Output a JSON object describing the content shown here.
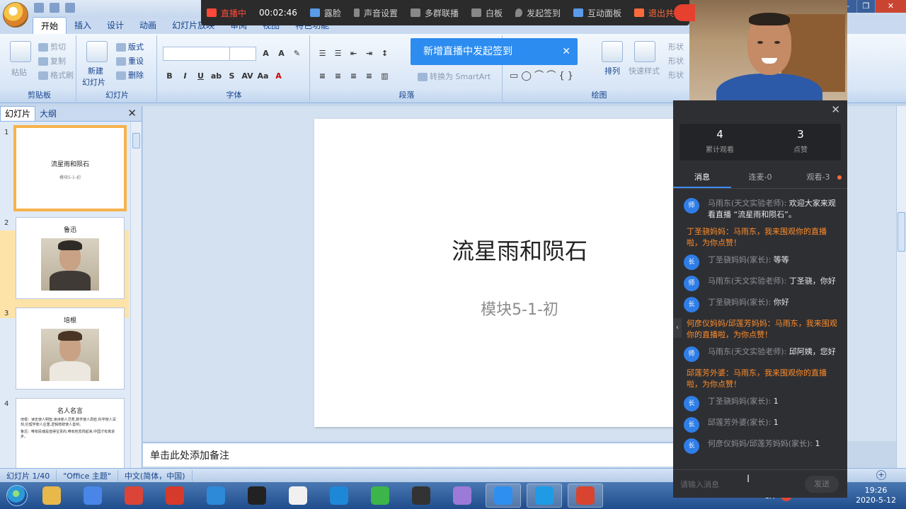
{
  "ppt": {
    "tabs": [
      "开始",
      "插入",
      "设计",
      "动画",
      "幻灯片放映",
      "审阅",
      "视图",
      "特色功能"
    ],
    "ribbon": {
      "clipboard": {
        "paste": "粘贴",
        "cut": "剪切",
        "copy": "复制",
        "format_painter": "格式刷",
        "label": "剪贴板"
      },
      "slides": {
        "new_slide": "新建",
        "new_slide2": "幻灯片",
        "layout": "版式",
        "reset": "重设",
        "delete": "删除",
        "label": "幻灯片"
      },
      "font": {
        "label": "字体"
      },
      "paragraph": {
        "convert_smartart": "转换为 SmartArt",
        "label": "段落"
      },
      "drawing": {
        "arrange": "排列",
        "quick_styles": "快速样式",
        "shape_fill": "形状",
        "shape_outline": "形状",
        "shape_effect": "形状",
        "label": "绘图"
      }
    },
    "panel_tabs": [
      "幻灯片",
      "大纲"
    ],
    "thumbs": [
      {
        "num": "1",
        "title": "流星雨和陨石",
        "sub": "模块5-1-初"
      },
      {
        "num": "2",
        "title": "鲁迅"
      },
      {
        "num": "3",
        "title": "培根"
      },
      {
        "num": "4",
        "title": "名人名言",
        "bullets": [
          "培根：读史使人明智,读诗使人灵秀,数学使人周密,科学使人深刻,伦理学使人庄重,逻辑修辞使人善辩。",
          "鲁迅：唯有民魂是值得宝贵的,唯有他发扬起来,中国才有真进步。"
        ]
      }
    ],
    "slide": {
      "title": "流星雨和陨石",
      "subtitle": "模块5-1-初"
    },
    "notes_placeholder": "单击此处添加备注",
    "status": {
      "slide_num": "幻灯片 1/40",
      "theme": "\"Office 主题\"",
      "lang": "中文(简体，中国)"
    }
  },
  "live": {
    "status": "直播中",
    "timer": "00:02:46",
    "camera": "露脸",
    "audio": "声音设置",
    "multi": "多群联播",
    "whiteboard": "白板",
    "signin": "发起签到",
    "interact": "互动面板",
    "exit": "退出共享",
    "toast": "新增直播中发起签到"
  },
  "chat": {
    "stats": {
      "views": "4",
      "views_label": "累计观看",
      "likes": "3",
      "likes_label": "点赞"
    },
    "tabs": [
      "消息",
      "连麦-0",
      "观看-3"
    ],
    "messages": [
      {
        "type": "user",
        "avatar": "师",
        "name": "马雨东(天文实验老师):",
        "text": "欢迎大家来观看直播 “流星雨和陨石”。"
      },
      {
        "type": "sys",
        "text": "丁圣骁妈妈：马雨东，我来围观你的直播啦，为你点赞！"
      },
      {
        "type": "user",
        "avatar": "长",
        "name": "丁圣骁妈妈(家长):",
        "text": "等等"
      },
      {
        "type": "user",
        "avatar": "师",
        "name": "马雨东(天文实验老师):",
        "text": "丁圣骁，你好"
      },
      {
        "type": "user",
        "avatar": "长",
        "name": "丁圣骁妈妈(家长):",
        "text": "你好"
      },
      {
        "type": "sys",
        "text": "何彦仪妈妈/邱莲芳妈妈：马雨东，我来围观你的直播啦，为你点赞！"
      },
      {
        "type": "user",
        "avatar": "师",
        "name": "马雨东(天文实验老师):",
        "text": "邱阿姨，您好"
      },
      {
        "type": "sys",
        "text": "邱莲芳外婆：马雨东，我来围观你的直播啦，为你点赞！"
      },
      {
        "type": "user",
        "avatar": "长",
        "name": "丁圣骁妈妈(家长):",
        "text": "1"
      },
      {
        "type": "user",
        "avatar": "长",
        "name": "邱莲芳外婆(家长):",
        "text": "1"
      },
      {
        "type": "user",
        "avatar": "长",
        "name": "何彦仪妈妈/邱莲芳妈妈(家长):",
        "text": "1"
      }
    ],
    "input_placeholder": "请输入消息",
    "send": "发送"
  },
  "taskbar": {
    "ime": "CH",
    "time": "19:26",
    "date": "2020-5-12",
    "apps": [
      "file-explorer",
      "photos",
      "chrome",
      "app-red",
      "edge-like",
      "camera",
      "document",
      "ie",
      "media",
      "app-bird",
      "paint",
      "app-blue-active",
      "app-tv-active",
      "powerpoint-active"
    ]
  }
}
